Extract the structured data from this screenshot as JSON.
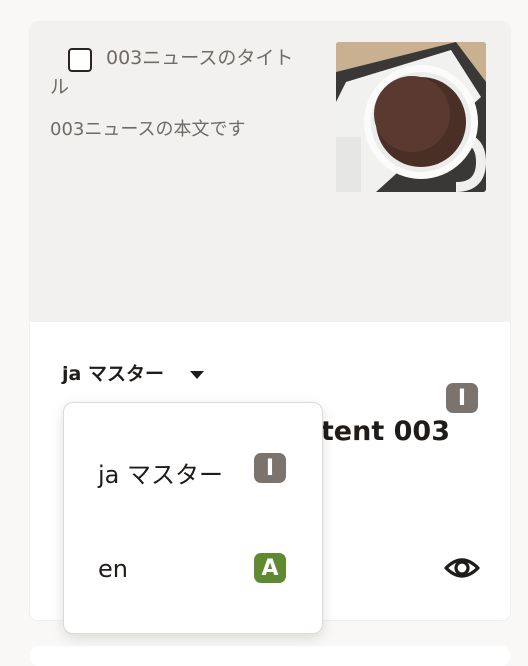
{
  "card": {
    "news_title": "003ニュースのタイトル",
    "news_body": "003ニュースの本文です",
    "thumbnail_icon": "coffee-cup-photo",
    "language_selected": "ja マスター",
    "status_badge": "I",
    "content_title_fragment": "tent 003"
  },
  "dropdown": {
    "items": [
      {
        "label": "ja マスター",
        "badge": "I",
        "badge_color": "#7a736e"
      },
      {
        "label": "en",
        "badge": "A",
        "badge_color": "#5f8a32"
      }
    ]
  },
  "colors": {
    "background": "#f9f8f6",
    "preview_bg": "#f2f1ef",
    "badge_in_progress": "#7a736e",
    "badge_approved": "#5f8a32"
  }
}
